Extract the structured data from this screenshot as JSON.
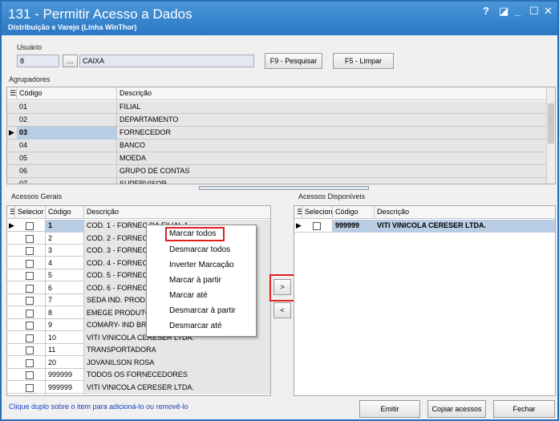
{
  "window": {
    "title": "131 - Permitir Acesso a Dados",
    "subtitle": "Distribuição e Varejo (Linha WinThor)",
    "controls": [
      "?",
      "◪",
      "_",
      "☐",
      "✕"
    ]
  },
  "usuario": {
    "label": "Usuário",
    "code": "8",
    "lookup_label": "...",
    "name": "CAIXA",
    "search_button": "F9 - Pesquisar",
    "clear_button": "F5 - Limpar"
  },
  "agrupadores": {
    "label": "Agrupadores",
    "columns": [
      "Código",
      "Descrição"
    ],
    "rows": [
      {
        "code": "01",
        "desc": "FILIAL"
      },
      {
        "code": "02",
        "desc": "DEPARTAMENTO"
      },
      {
        "code": "03",
        "desc": "FORNECEDOR"
      },
      {
        "code": "04",
        "desc": "BANCO"
      },
      {
        "code": "05",
        "desc": "MOEDA"
      },
      {
        "code": "06",
        "desc": "GRUPO DE CONTAS"
      },
      {
        "code": "07",
        "desc": "SUPERVISOR"
      }
    ]
  },
  "acessos_gerais": {
    "label": "Acessos Gerais",
    "columns": [
      "Selecior",
      "Código",
      "Descrição"
    ],
    "rows": [
      {
        "code": "1",
        "desc": "COD. 1 - FORNEC DA FILIAL 1"
      },
      {
        "code": "2",
        "desc": "COD. 2 - FORNEC"
      },
      {
        "code": "3",
        "desc": "COD. 3 - FORNEC"
      },
      {
        "code": "4",
        "desc": "COD. 4 - FORNEC"
      },
      {
        "code": "5",
        "desc": "COD. 5 - FORNEC"
      },
      {
        "code": "6",
        "desc": "COD. 6 - FORNEC"
      },
      {
        "code": "7",
        "desc": "SEDA IND. PROD."
      },
      {
        "code": "8",
        "desc": "EMEGE PRODUTOS"
      },
      {
        "code": "9",
        "desc": "COMARY- IND BRA"
      },
      {
        "code": "10",
        "desc": "VITI VINICOLA CERESER LTDA."
      },
      {
        "code": "11",
        "desc": "TRANSPORTADORA"
      },
      {
        "code": "20",
        "desc": "JOVANILSON ROSA"
      },
      {
        "code": "999999",
        "desc": "TODOS OS FORNECEDORES"
      },
      {
        "code": "999999",
        "desc": "VITI VINICOLA CERESER LTDA."
      }
    ]
  },
  "acessos_disponiveis": {
    "label": "Acessos Disponíveis",
    "columns": [
      "Selecion",
      "Código",
      "Descrição"
    ],
    "rows": [
      {
        "code": "999999",
        "desc": "VITI VINICOLA CERESER LTDA."
      }
    ]
  },
  "context_menu": {
    "items": [
      "Marcar todos",
      "Desmarcar todos",
      "Inverter Marcação",
      "Marcar à partir",
      "Marcar até",
      "Desmarcar à partir",
      "Desmarcar até"
    ]
  },
  "transfer": {
    "add_label": ">",
    "remove_label": "<"
  },
  "footer": {
    "hint": "Clique duplo sobre o item para adicioná-lo ou removê-lo",
    "emit_button": "Emitir",
    "copy_button": "Copiar acessos",
    "close_button": "Fechar"
  },
  "colors": {
    "titlebar": "#2a78c6",
    "highlight": "#e02020",
    "hint": "#1a3fc0",
    "selected_row": "#b8cce4"
  }
}
